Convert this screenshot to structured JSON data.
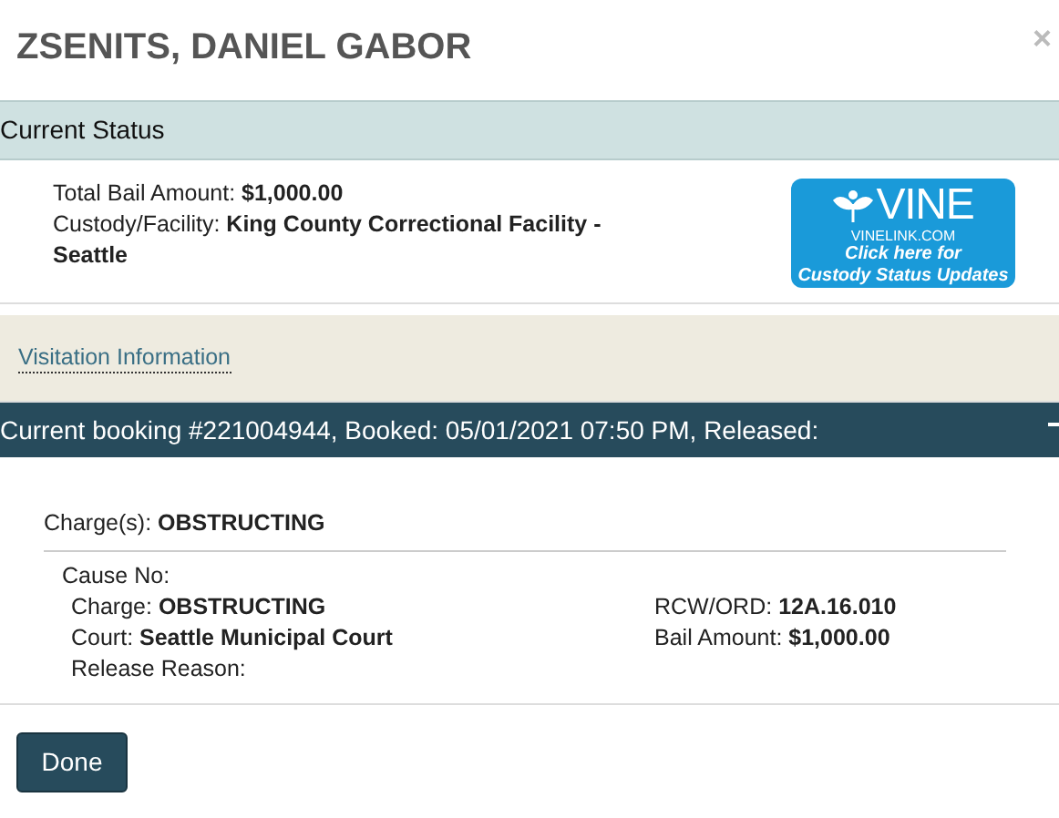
{
  "title": "ZSENITS, DANIEL GABOR",
  "close": "×",
  "status_header": "Current Status",
  "status_lines": [
    "Total Bail Amount: **$1,000.00**",
    "Custody/Facility: **King County Correctional Facility - Seattle**"
  ],
  "vine": {
    "name": "VINE",
    "site": "VINELINK.COM",
    "caption": [
      "Click here for",
      "Custody Status Updates"
    ]
  },
  "visitation_link": "Visitation Information",
  "booking": {
    "header": "Current booking #221004944, Booked: 05/01/2021 07:50 PM, Released:",
    "expanded": true
  },
  "charges_summary": "Charge(s): **OBSTRUCTING**",
  "cause_no": "Cause No:",
  "details_left": [
    "Charge: **OBSTRUCTING**",
    "Court: **Seattle Municipal Court**",
    "Release Reason:"
  ],
  "details_right": [
    "RCW/ORD: **12A.16.010**",
    "Bail Amount: **$1,000.00**"
  ],
  "done_button": "Done"
}
